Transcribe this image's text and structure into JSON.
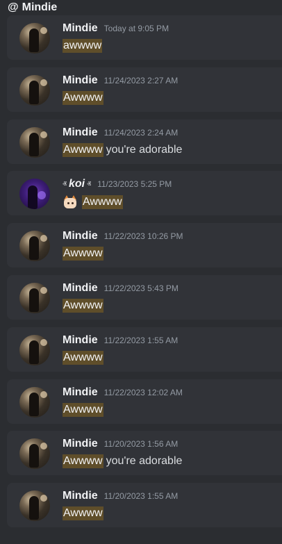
{
  "header": {
    "at_symbol": "@",
    "title": "Mindie"
  },
  "messages": [
    {
      "username": "Mindie",
      "timestamp": "Today at 9:05 PM",
      "highlight": "awwww",
      "rest": ""
    },
    {
      "username": "Mindie",
      "timestamp": "11/24/2023 2:27 AM",
      "highlight": "Awwww",
      "rest": ""
    },
    {
      "username": "Mindie",
      "timestamp": "11/24/2023 2:24 AM",
      "highlight": "Awwww",
      "rest": "you're adorable"
    },
    {
      "username": "koi",
      "timestamp": "11/23/2023 5:25 PM",
      "highlight": "Awwww",
      "rest": "",
      "emoji": "cat-face-emoji",
      "decoration_left": "ⱏ",
      "decoration_right": "ⱏ"
    },
    {
      "username": "Mindie",
      "timestamp": "11/22/2023 10:26 PM",
      "highlight": "Awwww",
      "rest": ""
    },
    {
      "username": "Mindie",
      "timestamp": "11/22/2023 5:43 PM",
      "highlight": "Awwww",
      "rest": ""
    },
    {
      "username": "Mindie",
      "timestamp": "11/22/2023 1:55 AM",
      "highlight": "Awwww",
      "rest": ""
    },
    {
      "username": "Mindie",
      "timestamp": "11/22/2023 12:02 AM",
      "highlight": "Awwww",
      "rest": ""
    },
    {
      "username": "Mindie",
      "timestamp": "11/20/2023 1:56 AM",
      "highlight": "Awwww",
      "rest": "you're adorable"
    },
    {
      "username": "Mindie",
      "timestamp": "11/20/2023 1:55 AM",
      "highlight": "Awwww",
      "rest": ""
    }
  ],
  "colors": {
    "background": "#2b2d31",
    "card": "#313338",
    "highlight": "#5f4e2a",
    "timestamp": "#949ba4"
  }
}
